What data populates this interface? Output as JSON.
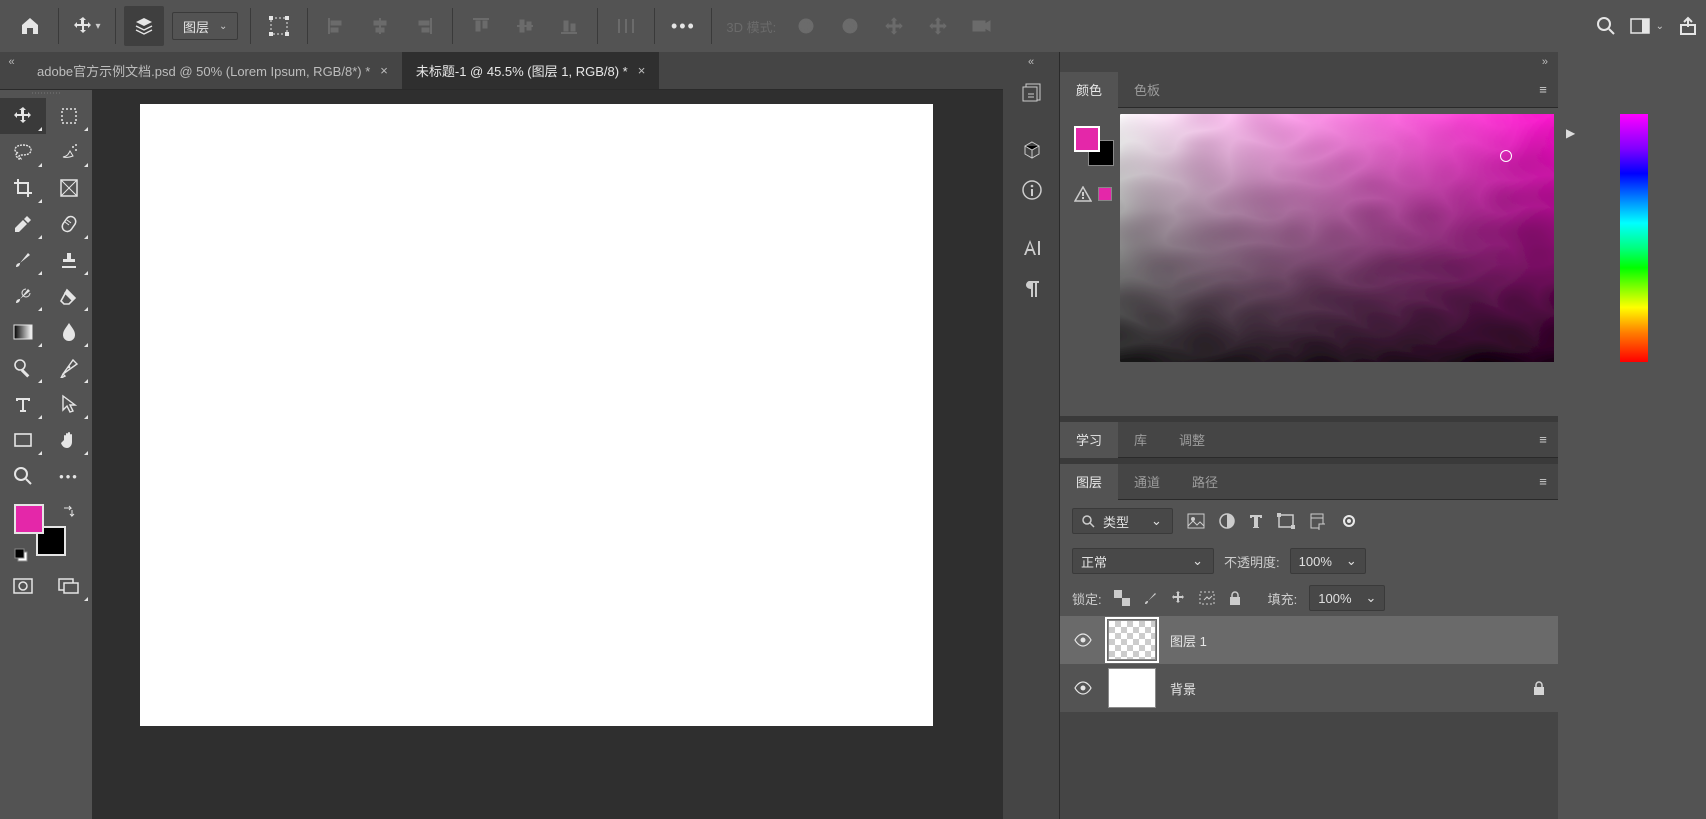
{
  "optbar": {
    "layer_drop_label": "图层",
    "mode3d_label": "3D 模式:"
  },
  "tabs": [
    {
      "title": "adobe官方示例文档.psd @ 50% (Lorem Ipsum, RGB/8*) *",
      "active": false
    },
    {
      "title": "未标题-1 @ 45.5% (图层 1, RGB/8) *",
      "active": true
    }
  ],
  "color_panel": {
    "tab_color": "颜色",
    "tab_swatch": "色板",
    "fg_hex": "#e427a9",
    "bg_hex": "#000000",
    "warn_swatch": "#e427a9"
  },
  "mid_panel": {
    "tab_learn": "学习",
    "tab_lib": "库",
    "tab_adjust": "调整"
  },
  "layers_panel": {
    "tab_layers": "图层",
    "tab_channels": "通道",
    "tab_paths": "路径",
    "filter_type": "类型",
    "blend_mode": "正常",
    "opacity_label": "不透明度:",
    "opacity_value": "100%",
    "lock_label": "锁定:",
    "fill_label": "填充:",
    "fill_value": "100%",
    "items": [
      {
        "name": "图层 1",
        "selected": true,
        "trans": true,
        "locked": false
      },
      {
        "name": "背景",
        "selected": false,
        "trans": false,
        "locked": true
      }
    ]
  }
}
